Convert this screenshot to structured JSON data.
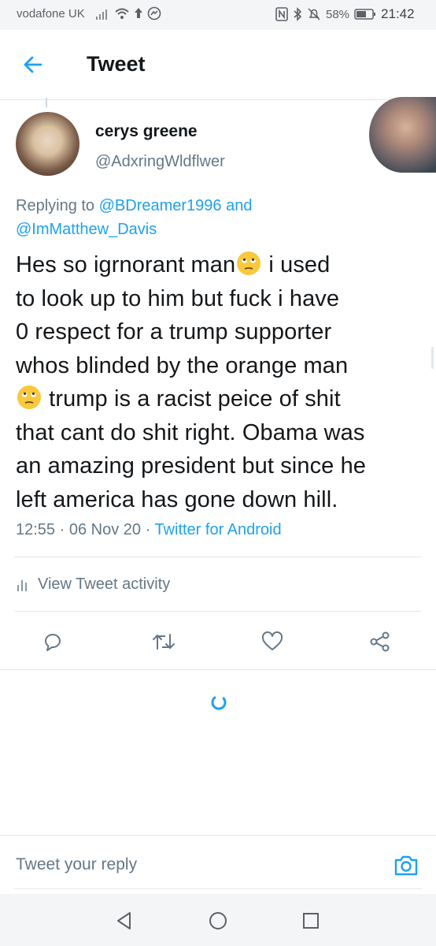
{
  "status_bar": {
    "carrier": "vodafone UK",
    "battery": "58%",
    "time": "21:42",
    "icons": [
      "signal-icon",
      "wifi-icon",
      "upload-icon",
      "messenger-icon",
      "nfc-icon",
      "bluetooth-icon",
      "mute-icon",
      "battery-icon"
    ]
  },
  "header": {
    "title": "Tweet",
    "back_icon": "back-arrow-icon"
  },
  "tweet": {
    "display_name": "cerys greene",
    "handle": "@AdxringWldflwer",
    "replying_prefix": "Replying to ",
    "reply_mention_1": "@BDreamer1996",
    "reply_and": " and",
    "reply_mention_2": "@ImMatthew_Davis",
    "text_lines": [
      "Hes so igrnorant man",
      " i used",
      "to look up to him but fuck i have",
      "0 respect for a trump supporter",
      "whos blinded by the orange man",
      " trump is a racist peice of shit",
      "that cant do shit right. Obama was",
      "an amazing president but since he",
      "left america has gone down hill."
    ],
    "time": "12:55",
    "separator": " · ",
    "date": "06 Nov 20",
    "source": "Twitter for Android"
  },
  "activity": {
    "label": "View Tweet activity",
    "icon": "analytics-icon"
  },
  "actions": [
    "reply-icon",
    "retweet-icon",
    "like-icon",
    "share-icon"
  ],
  "reply_bar": {
    "placeholder": "Tweet your reply",
    "camera_icon": "camera-icon"
  },
  "nav_bar": [
    "back-triangle-icon",
    "home-circle-icon",
    "recents-square-icon"
  ],
  "colors": {
    "accent": "#1da1f2",
    "text": "#14171a",
    "secondary": "#657786",
    "divider": "#e1e8ed",
    "system_bar": "#f4f5f7"
  }
}
